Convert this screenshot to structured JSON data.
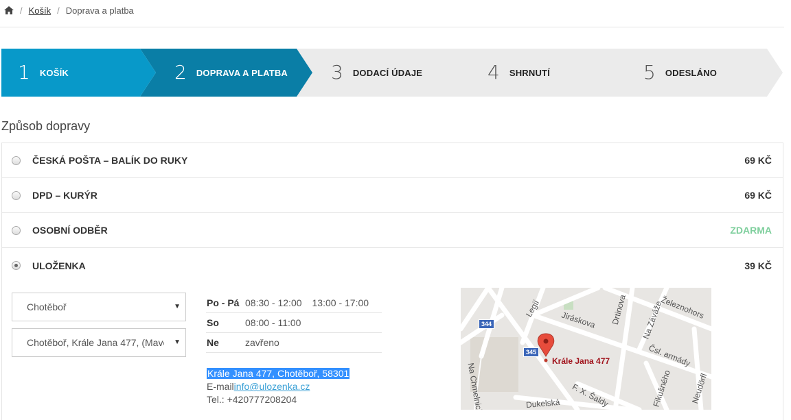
{
  "breadcrumb": {
    "home_icon": "home-icon",
    "separator": "/",
    "items": [
      "Košík",
      "Doprava a platba"
    ]
  },
  "steps": [
    {
      "num": "1",
      "label": "KOŠÍK",
      "state": "done"
    },
    {
      "num": "2",
      "label": "DOPRAVA A PLATBA",
      "state": "current"
    },
    {
      "num": "3",
      "label": "DODACÍ ÚDAJE",
      "state": "todo"
    },
    {
      "num": "4",
      "label": "SHRNUTÍ",
      "state": "todo"
    },
    {
      "num": "5",
      "label": "ODESLÁNO",
      "state": "todo"
    }
  ],
  "colors": {
    "step_done": "#0899c9",
    "step_current": "#0a7ea6",
    "step_todo": "#ebebeb",
    "free": "#7fcf9d"
  },
  "shipping": {
    "title": "Způsob dopravy",
    "options": [
      {
        "name": "ČESKÁ POŠTA – BALÍK DO RUKY",
        "price": "69 KČ",
        "selected": false
      },
      {
        "name": "DPD – KURÝR",
        "price": "69 KČ",
        "selected": false
      },
      {
        "name": "OSOBNÍ ODBĚR",
        "price": "ZDARMA",
        "selected": false
      },
      {
        "name": "ULOŽENKA",
        "price": "39 KČ",
        "selected": true
      }
    ]
  },
  "ulozenka": {
    "city_select": "Chotěboř",
    "branch_select": "Chotěboř, Krále Jana 477, (Mave",
    "hours": [
      {
        "day": "Po - Pá",
        "times": [
          "08:30 - 12:00",
          "13:00 - 17:00"
        ]
      },
      {
        "day": "So",
        "times": [
          "08:00 - 11:00"
        ]
      },
      {
        "day": "Ne",
        "times": [
          "zavřeno"
        ]
      }
    ],
    "address": "Krále Jana 477, Chotěboř, 58301",
    "email_label": "E-mail",
    "email": "info@ulozenka.cz",
    "phone": "Tel.: +420777208204"
  },
  "map": {
    "pin_label": "Krále Jana 477",
    "shields": [
      "344",
      "345"
    ],
    "streets": [
      "Legií",
      "Jiráskova",
      "Drtinova",
      "Železnohors",
      "Na Záváže",
      "Čsl. armády",
      "Na Chmelnici",
      "F. X. Šaldy",
      "Dukelská",
      "Fikušného",
      "Neudörfl"
    ]
  }
}
